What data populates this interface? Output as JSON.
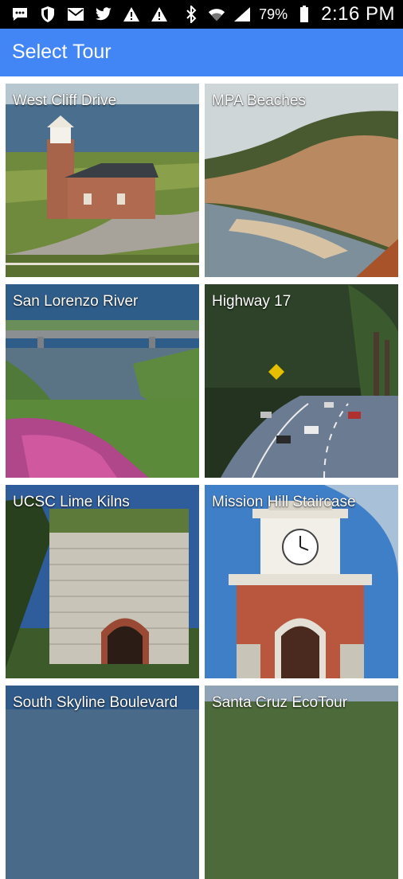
{
  "status_bar": {
    "battery_percent": "79%",
    "time": "2:16 PM",
    "left_icons": [
      "messaging-icon",
      "shield-icon",
      "mail-icon",
      "twitter-icon",
      "warning-icon",
      "warning-icon"
    ],
    "right_icons": [
      "bluetooth-icon",
      "wifi-icon",
      "signal-icon",
      "battery-icon"
    ]
  },
  "app_bar": {
    "title": "Select Tour",
    "color": "#4285f4"
  },
  "tours": [
    {
      "label": "West Cliff Drive"
    },
    {
      "label": "MPA Beaches"
    },
    {
      "label": "San Lorenzo River"
    },
    {
      "label": "Highway 17"
    },
    {
      "label": "UCSC Lime Kilns"
    },
    {
      "label": "Mission Hill Staircase"
    },
    {
      "label": "South Skyline Boulevard"
    },
    {
      "label": "Santa Cruz EcoTour"
    }
  ]
}
